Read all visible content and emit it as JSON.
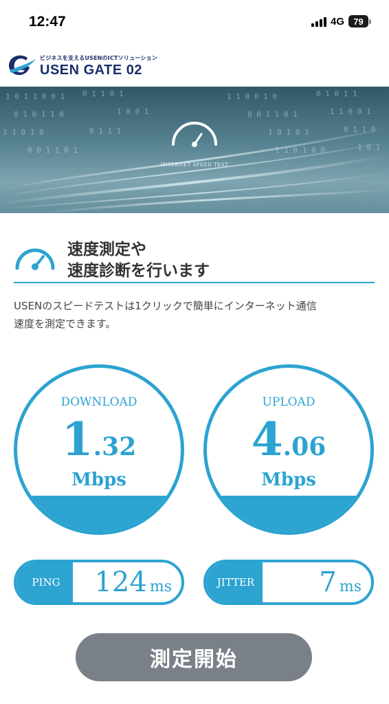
{
  "status_bar": {
    "time": "12:47",
    "network": "4G",
    "battery": "79"
  },
  "header": {
    "brand_tagline": "ビジネスを支えるUSENのICTソリューション",
    "brand_name": "USEN GATE 02"
  },
  "hero": {
    "title": "INTERNET SPEED TEST"
  },
  "section": {
    "title_line1": "速度測定や",
    "title_line2": "速度診断を行います",
    "description_line1": "USENのスピードテストは1クリックで簡単にインターネット通信",
    "description_line2": "速度を測定できます。"
  },
  "download": {
    "label": "DOWNLOAD",
    "value_int": "1",
    "value_dec": ".32",
    "unit": "Mbps"
  },
  "upload": {
    "label": "UPLOAD",
    "value_int": "4",
    "value_dec": ".06",
    "unit": "Mbps"
  },
  "ping": {
    "label": "PING",
    "value": "124",
    "unit": "ms"
  },
  "jitter": {
    "label": "JITTER",
    "value": "7",
    "unit": "ms"
  },
  "start_button": {
    "label": "測定開始"
  },
  "colors": {
    "accent": "#2ca3d1",
    "button": "#7a8088",
    "brand": "#1a2d6b"
  }
}
